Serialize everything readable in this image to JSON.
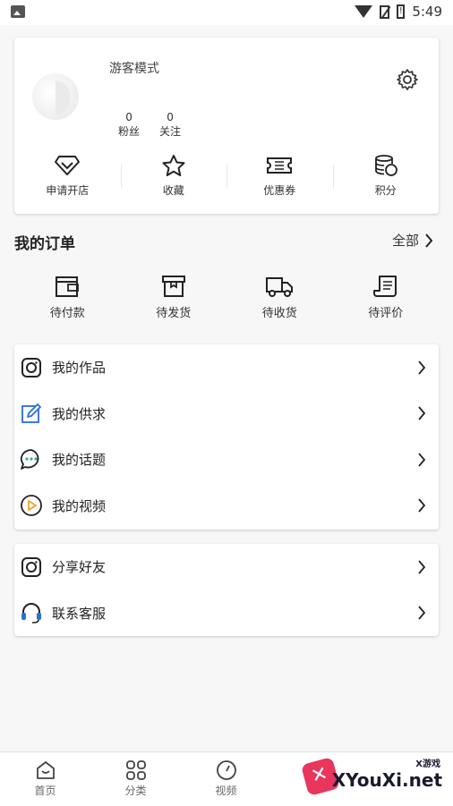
{
  "status_bar": {
    "time": "5:49",
    "battery_glyph": "!"
  },
  "profile": {
    "username": "游客模式",
    "followers_count": "0",
    "followers_label": "粉丝",
    "following_count": "0",
    "following_label": "关注",
    "shortcuts": [
      {
        "label": "申请开店",
        "icon": "diamond-icon"
      },
      {
        "label": "收藏",
        "icon": "star-icon"
      },
      {
        "label": "优惠券",
        "icon": "ticket-icon"
      },
      {
        "label": "积分",
        "icon": "coins-icon"
      }
    ]
  },
  "orders": {
    "title": "我的订单",
    "all_label": "全部",
    "items": [
      {
        "label": "待付款",
        "icon": "wallet-icon"
      },
      {
        "label": "待发货",
        "icon": "box-icon"
      },
      {
        "label": "待收货",
        "icon": "truck-icon"
      },
      {
        "label": "待评价",
        "icon": "review-icon"
      }
    ]
  },
  "menu_group1": [
    {
      "label": "我的作品",
      "icon": "camera-icon"
    },
    {
      "label": "我的供求",
      "icon": "pencil-icon"
    },
    {
      "label": "我的话题",
      "icon": "chat-bubble-icon"
    },
    {
      "label": "我的视频",
      "icon": "play-icon"
    }
  ],
  "menu_group2": [
    {
      "label": "分享好友",
      "icon": "camera-icon"
    },
    {
      "label": "联系客服",
      "icon": "headset-icon"
    }
  ],
  "bottom_nav": [
    {
      "label": "首页",
      "icon": "home-icon"
    },
    {
      "label": "分类",
      "icon": "grid-icon"
    },
    {
      "label": "视频",
      "icon": "compass-icon"
    }
  ],
  "watermark": {
    "brand": "XYouXi.net",
    "sub": "X游戏"
  },
  "colors": {
    "green_dots": "#3cb371",
    "orange_play": "#f0a030",
    "blue_pencil": "#2a6fd6",
    "blue_headset": "#2a6fd6"
  }
}
